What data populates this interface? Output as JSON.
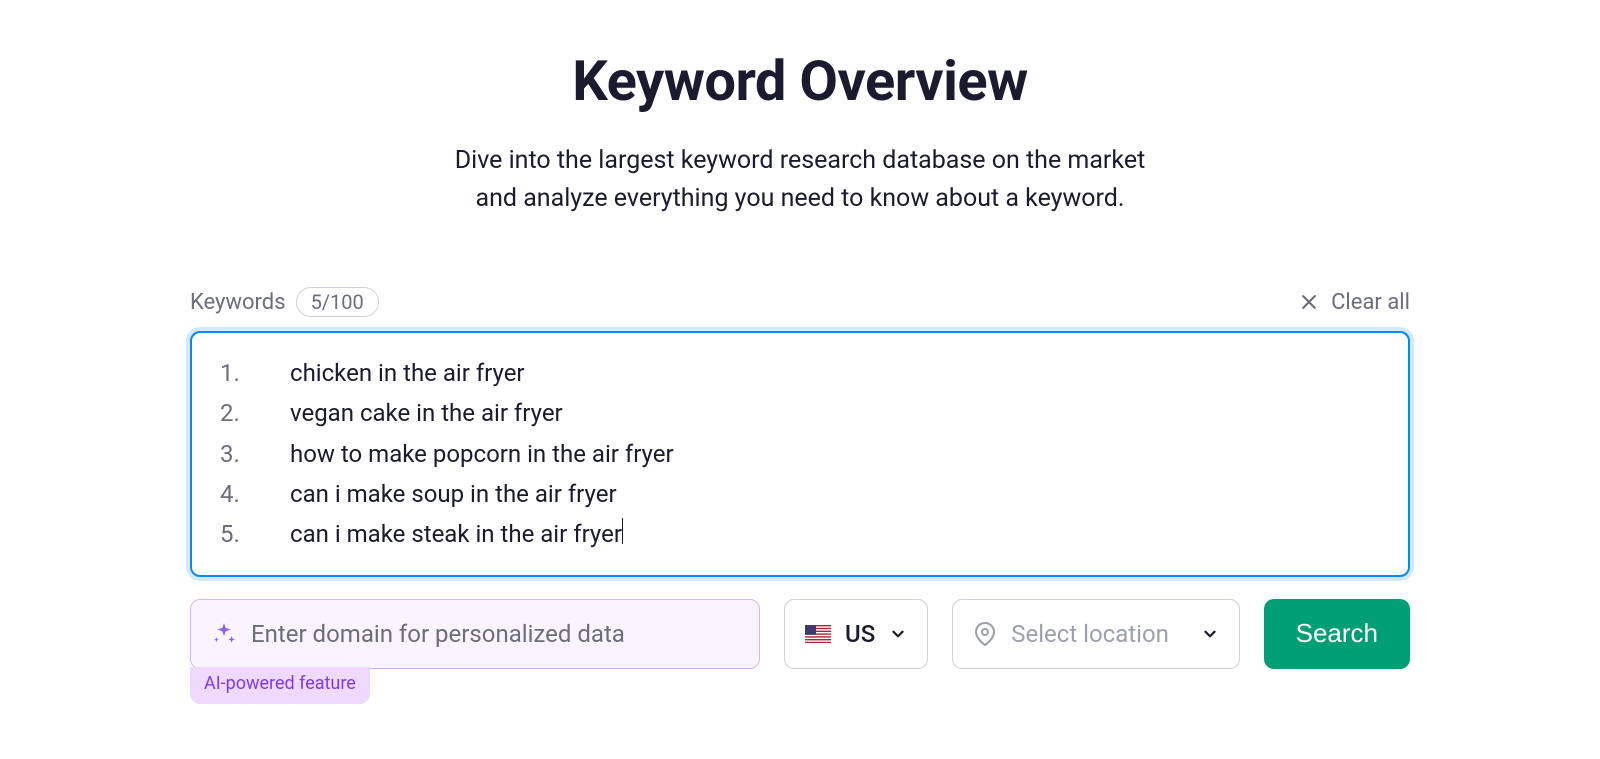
{
  "header": {
    "title": "Keyword Overview",
    "subtitle_line1": "Dive into the largest keyword research database on the market",
    "subtitle_line2": "and analyze everything you need to know about a keyword."
  },
  "keywords_section": {
    "label": "Keywords",
    "count_badge": "5/100",
    "clear_all_label": "Clear all",
    "keywords": [
      "chicken in the air fryer",
      "vegan cake in the air fryer",
      "how to make popcorn in the air fryer",
      "can i make soup in the air fryer",
      "can i make steak in the air fryer"
    ]
  },
  "controls": {
    "domain_placeholder": "Enter domain for personalized data",
    "ai_badge_label": "AI-powered feature",
    "country_code": "US",
    "location_placeholder": "Select location",
    "search_button_label": "Search"
  }
}
